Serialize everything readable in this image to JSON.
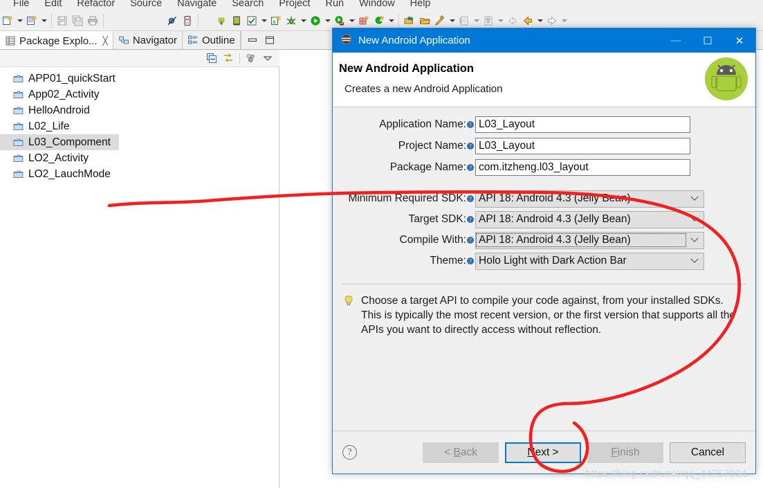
{
  "app": {
    "menus": [
      "File",
      "Edit",
      "Refactor",
      "Source",
      "Navigate",
      "Search",
      "Project",
      "Run",
      "Window",
      "Help"
    ]
  },
  "toolbar": {
    "icons": [
      "new-file-icon",
      "new-file-dropdown-arrow",
      "new-wizard-icon",
      "new-wizard-dropdown-arrow",
      "save-icon",
      "save-all-icon",
      "print-icon",
      "toggle-breakpoint-icon",
      "ddms-icon",
      "sdk-manager-icon",
      "avd-manager-icon",
      "check-icon",
      "check-dropdown-arrow",
      "new-android-project-icon",
      "debug-icon",
      "debug-dropdown-arrow",
      "run-icon",
      "run-dropdown-arrow",
      "run-as-server-icon",
      "run-as-dropdown-arrow",
      "new-plugin-icon",
      "coverage-icon",
      "coverage-dropdown-arrow",
      "open-perspective-icon",
      "open-type-icon",
      "search-icon",
      "search-dropdown-arrow",
      "next-annotation-icon",
      "next-annotation-dropdown-arrow",
      "previous-edit-icon",
      "previous-edit-dropdown-arrow",
      "back-disabled-icon",
      "back-icon",
      "back-dropdown-arrow",
      "forward-icon",
      "forward-dropdown-arrow"
    ]
  },
  "left_panel": {
    "tabs": [
      {
        "label": "Package Explo...",
        "icon": "package-explorer-icon",
        "active": true,
        "closable": true
      },
      {
        "label": "Navigator",
        "icon": "navigator-icon",
        "active": false,
        "closable": false
      },
      {
        "label": "Outline",
        "icon": "outline-icon",
        "active": false,
        "closable": false
      }
    ],
    "window_controls": [
      "minimize-icon",
      "maximize-icon"
    ],
    "view_toolbar": [
      "collapse-all-icon",
      "link-with-editor-icon",
      "view-menu-filters-icon",
      "view-menu-icon"
    ],
    "tree_items": [
      {
        "label": "APP01_quickStart",
        "selected": false
      },
      {
        "label": "App02_Activity",
        "selected": false
      },
      {
        "label": "HelloAndroid",
        "selected": false
      },
      {
        "label": "L02_Life",
        "selected": false
      },
      {
        "label": "L03_Compoment",
        "selected": true
      },
      {
        "label": "LO2_Activity",
        "selected": false
      },
      {
        "label": "LO2_LauchMode",
        "selected": false
      }
    ]
  },
  "dialog": {
    "title": "New Android Application",
    "title_icon": "eclipse-wizard-icon",
    "window_buttons": [
      {
        "name": "minimize",
        "glyph": "—",
        "enabled": false
      },
      {
        "name": "maximize",
        "glyph": "☐",
        "enabled": true
      },
      {
        "name": "close",
        "glyph": "✕",
        "enabled": true
      }
    ],
    "heading": "New Android Application",
    "subheading": "Creates a new Android Application",
    "header_icon": "android-robot-icon",
    "fields": [
      {
        "label": "Application Name:",
        "value": "L03_Layout",
        "type": "text"
      },
      {
        "label": "Project Name:",
        "value": "L03_Layout",
        "type": "text"
      },
      {
        "label": "Package Name:",
        "value": "com.itzheng.l03_layout",
        "type": "text"
      }
    ],
    "combos": [
      {
        "label": "Minimum Required SDK:",
        "value": "API 18: Android 4.3 (Jelly Bean)",
        "focused": false
      },
      {
        "label": "Target SDK:",
        "value": "API 18: Android 4.3 (Jelly Bean)",
        "focused": false
      },
      {
        "label": "Compile With:",
        "value": "API 18: Android 4.3 (Jelly Bean)",
        "focused": true
      },
      {
        "label": "Theme:",
        "value": "Holo Light with Dark Action Bar",
        "focused": false
      }
    ],
    "hint_icon": "lightbulb-icon",
    "hint_text": "Choose a target API to compile your code against, from your installed SDKs. This is typically the most recent version, or the first version that supports all the APIs you want to directly access without reflection.",
    "footer": {
      "help_button": "?",
      "buttons": [
        {
          "name": "back-button",
          "label": "< Back",
          "underline": "B",
          "state": "disabled"
        },
        {
          "name": "next-button",
          "label": "Next >",
          "underline": "N",
          "state": "focused"
        },
        {
          "name": "finish-button",
          "label": "Finish",
          "underline": "F",
          "state": "disabled"
        },
        {
          "name": "cancel-button",
          "label": "Cancel",
          "underline": "",
          "state": "enabled"
        }
      ]
    }
  },
  "annotation": {
    "color": "#f41f1f",
    "description": "hand-drawn red circle around Next button"
  },
  "watermark": {
    "text": "https://blog.csdn.net/qq_44757034",
    "color": "#cfd6dc"
  }
}
